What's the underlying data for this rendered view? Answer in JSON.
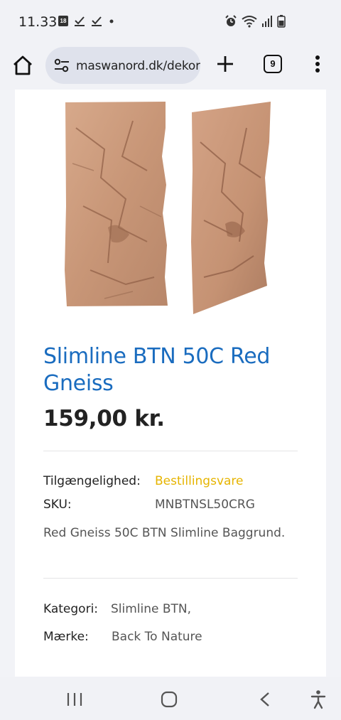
{
  "status_bar": {
    "time": "11.33",
    "calendar_day": "18",
    "left_icons": [
      "calendar-icon",
      "check-icon",
      "check-icon",
      "dot-icon"
    ],
    "right_icons": [
      "alarm-icon",
      "wifi-icon",
      "signal-icon",
      "battery-icon"
    ]
  },
  "browser": {
    "url": "maswanord.dk/dekora",
    "tab_count": "9"
  },
  "product": {
    "title": "Slimline BTN 50C Red Gneiss",
    "price": "159,00 kr.",
    "availability_label": "Tilgængelighed:",
    "availability_value": "Bestillingsvare",
    "sku_label": "SKU:",
    "sku_value": "MNBTNSL50CRG",
    "description": "Red Gneiss 50C BTN Slimline Baggrund.",
    "category_label": "Kategori:",
    "category_value": "Slimline BTN,",
    "brand_label": "Mærke:",
    "brand_value": "Back To Nature"
  },
  "colors": {
    "title": "#1a6cbf",
    "availability": "#e6b400",
    "stone": "#c99a7c"
  },
  "nav_bar": {
    "icons": [
      "recent-apps-icon",
      "home-circle-icon",
      "back-icon",
      "accessibility-icon"
    ]
  }
}
